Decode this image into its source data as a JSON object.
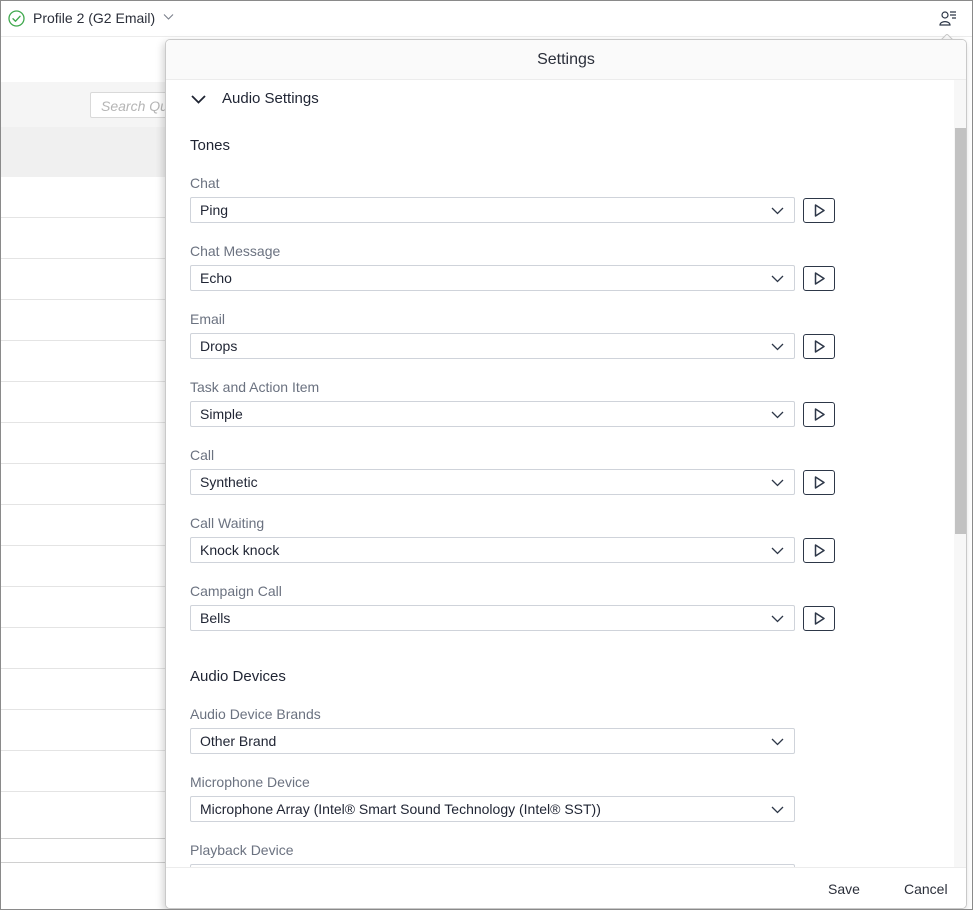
{
  "topbar": {
    "profile_label": "Profile 2 (G2 Email)",
    "status_color": "#3ea84c"
  },
  "background": {
    "search_placeholder": "Search Qu"
  },
  "settings": {
    "title": "Settings",
    "section_title": "Audio Settings",
    "tones": {
      "title": "Tones",
      "fields": [
        {
          "label": "Chat",
          "value": "Ping"
        },
        {
          "label": "Chat Message",
          "value": "Echo"
        },
        {
          "label": "Email",
          "value": "Drops"
        },
        {
          "label": "Task and Action Item",
          "value": "Simple"
        },
        {
          "label": "Call",
          "value": "Synthetic"
        },
        {
          "label": "Call Waiting",
          "value": "Knock knock"
        },
        {
          "label": "Campaign Call",
          "value": "Bells"
        }
      ]
    },
    "devices": {
      "title": "Audio Devices",
      "fields": [
        {
          "label": "Audio Device Brands",
          "value": "Other Brand"
        },
        {
          "label": "Microphone Device",
          "value": "Microphone Array (Intel® Smart Sound Technology (Intel® SST))"
        },
        {
          "label": "Playback Device",
          "value": ""
        }
      ]
    },
    "footer": {
      "save_label": "Save",
      "cancel_label": "Cancel"
    }
  }
}
